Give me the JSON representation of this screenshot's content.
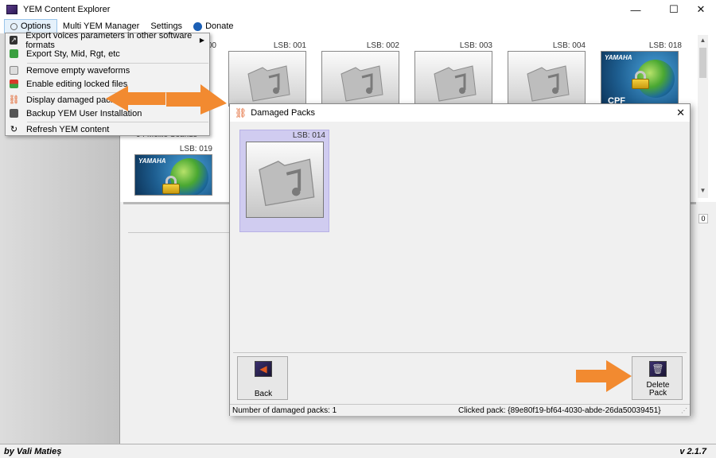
{
  "window": {
    "title": "YEM Content Explorer",
    "minimize": "—",
    "maximize": "☐",
    "close": "✕"
  },
  "menubar": {
    "options": "Options",
    "multi_yem_manager": "Multi YEM Manager",
    "settings": "Settings",
    "donate": "Donate"
  },
  "options_menu": {
    "items": [
      {
        "label": "Export voices parameters in other software formats",
        "icon": "export-icon",
        "submenu": true
      },
      {
        "label": "Export Sty, Mid, Rgt, etc",
        "icon": "export-styles-icon"
      },
      {
        "label": "Remove empty waveforms",
        "icon": "trash-icon"
      },
      {
        "label": "Enable editing locked files",
        "icon": "unlock-icon"
      },
      {
        "label": "Display damaged packs",
        "icon": "broken-link-icon"
      },
      {
        "label": "Backup YEM User Installation",
        "icon": "backup-icon"
      },
      {
        "label": "Refresh YEM content",
        "icon": "refresh-icon"
      }
    ]
  },
  "grid": {
    "packs": [
      {
        "lsb": "00"
      },
      {
        "lsb": "LSB: 001"
      },
      {
        "lsb": "LSB: 002"
      },
      {
        "lsb": "LSB: 003"
      },
      {
        "lsb": "LSB: 004"
      },
      {
        "lsb": "LSB: 018",
        "brand": "YAMAHA",
        "caption": "CPF"
      },
      {
        "lsb": "LSB: 019",
        "brand": "YAMAHA"
      }
    ],
    "partial_label": "04 Mellie Sounds",
    "number_box": "0"
  },
  "dialog": {
    "title": "Damaged Packs",
    "close": "✕",
    "pack_lsb": "LSB: 014",
    "back_label": "Back",
    "delete_label_1": "Delete",
    "delete_label_2": "Pack",
    "status_count": "Number of damaged packs: 1",
    "status_clicked": "Clicked pack: {89e80f19-bf64-4030-abde-26da50039451}"
  },
  "statusbar": {
    "author": "by Vali Matieș",
    "version": "v 2.1.7"
  },
  "colors": {
    "accent_orange": "#f28a30",
    "selection_lavender": "#d0ccf0",
    "menu_highlight": "#e5f1fb"
  }
}
